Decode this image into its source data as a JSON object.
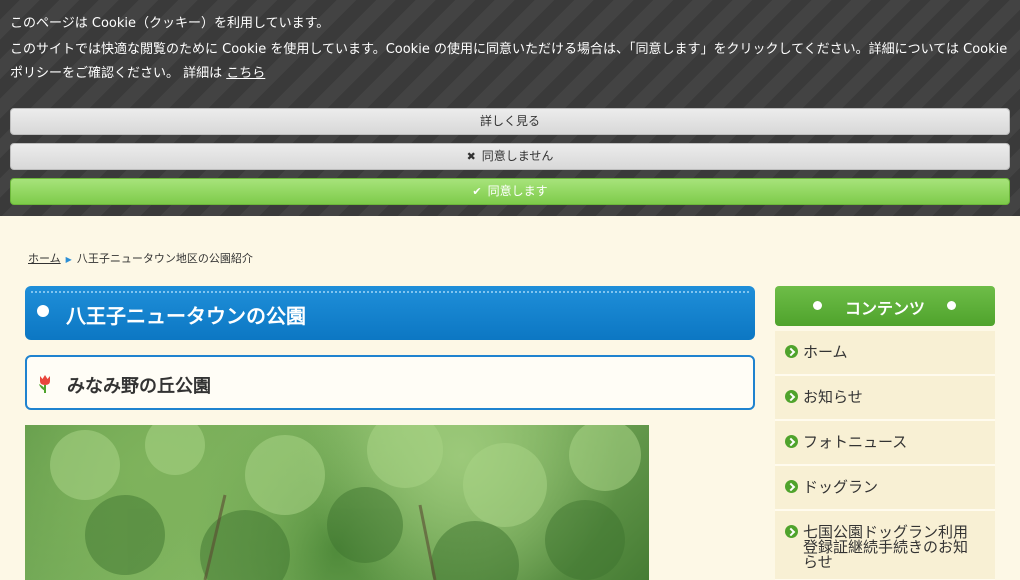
{
  "cookie": {
    "title": "このページは Cookie（クッキー）を利用しています。",
    "text": "このサイトでは快適な閲覧のために Cookie を使用しています。Cookie の使用に同意いただける場合は、「同意します」をクリックしてください。詳細については Cookie ポリシーをご確認ください。 詳細は ",
    "link": "こちら",
    "more_label": "詳しく見る",
    "decline_label": "同意しません",
    "accept_label": "同意します"
  },
  "breadcrumb": {
    "home": "ホーム",
    "current": "八王子ニュータウン地区の公園紹介"
  },
  "page": {
    "title": "八王子ニュータウンの公園",
    "subtitle": "みなみ野の丘公園"
  },
  "sidebar": {
    "heading": "コンテンツ",
    "items": [
      {
        "label": "ホーム"
      },
      {
        "label": "お知らせ"
      },
      {
        "label": "フォトニュース"
      },
      {
        "label": "ドッグラン"
      },
      {
        "label": "七国公園ドッグラン利用登録証継続手続きのお知らせ"
      }
    ]
  },
  "colors": {
    "title_blue": "#0c77c3",
    "accent_green": "#4fa32c",
    "background": "#fdf8e6"
  }
}
